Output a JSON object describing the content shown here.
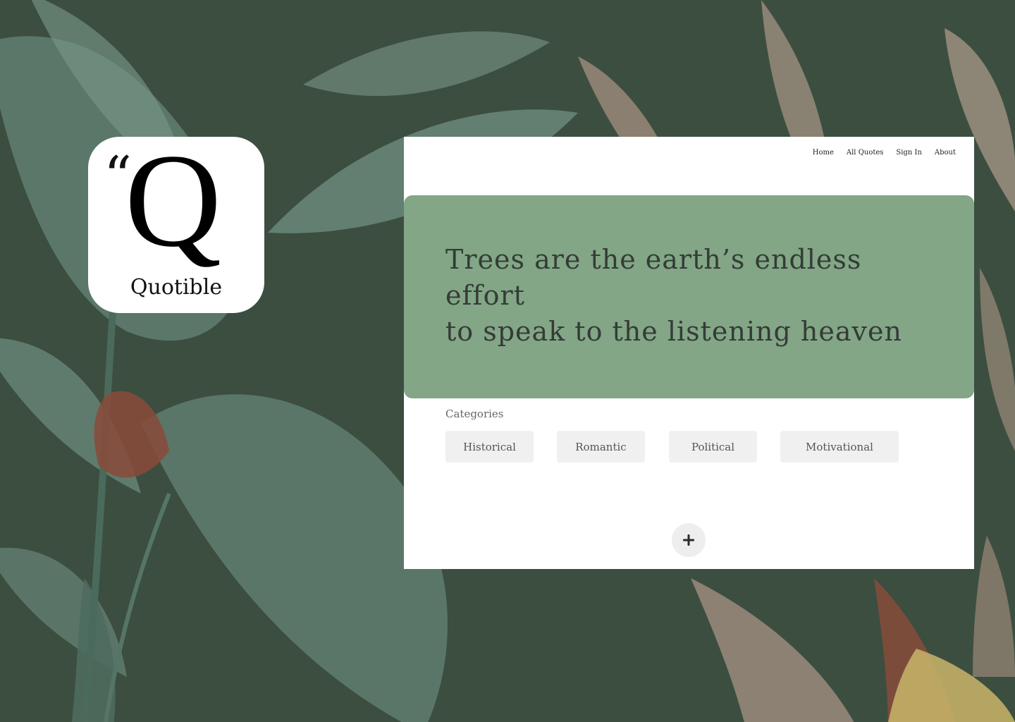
{
  "app_icon": {
    "quote_glyph": "“",
    "letter": "Q",
    "name": "Quotible"
  },
  "nav": {
    "items": [
      {
        "label": "Home"
      },
      {
        "label": "All Quotes"
      },
      {
        "label": "Sign In"
      },
      {
        "label": "About"
      }
    ]
  },
  "hero": {
    "quote_line1": "Trees are the earth’s endless effort",
    "quote_line2": "to speak to the listening heaven"
  },
  "categories": {
    "label": "Categories",
    "items": [
      {
        "label": "Historical"
      },
      {
        "label": "Romantic"
      },
      {
        "label": "Political"
      },
      {
        "label": "Motivational"
      }
    ]
  },
  "add_button": {
    "icon": "plus-icon"
  },
  "colors": {
    "background": "#3c4e40",
    "hero": "#82a686",
    "chip": "#f0f0f0",
    "text_dark": "#353b37"
  }
}
